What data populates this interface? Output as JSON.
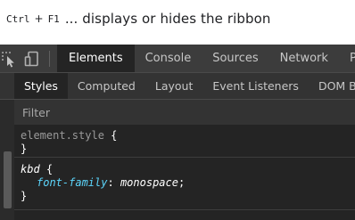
{
  "caption": {
    "key1": "Ctrl",
    "plus": "+",
    "key2": "F1",
    "text": "... displays or hides the ribbon"
  },
  "toolbar": {
    "tools": [
      {
        "icon": "inspect-element-icon"
      },
      {
        "icon": "device-toggle-icon"
      }
    ],
    "tabs": [
      {
        "label": "Elements",
        "active": true
      },
      {
        "label": "Console"
      },
      {
        "label": "Sources"
      },
      {
        "label": "Network"
      },
      {
        "label": "Perfo"
      }
    ]
  },
  "subtabs": [
    {
      "label": "Styles",
      "active": true
    },
    {
      "label": "Computed"
    },
    {
      "label": "Layout"
    },
    {
      "label": "Event Listeners"
    },
    {
      "label": "DOM Breakpoints"
    }
  ],
  "filter": {
    "placeholder": "Filter"
  },
  "rules": [
    {
      "selector": "element.style",
      "open": "{",
      "close": "}",
      "declarations": []
    },
    {
      "selector": "kbd",
      "open": "{",
      "close": "}",
      "declarations": [
        {
          "property": "font-family",
          "colon": ":",
          "value": "monospace",
          "semicolon": ";"
        }
      ]
    }
  ],
  "colors": {
    "devtools_bg": "#242424",
    "toolbar_bg": "#3c3c3c",
    "property_color": "#5cd5fb"
  }
}
